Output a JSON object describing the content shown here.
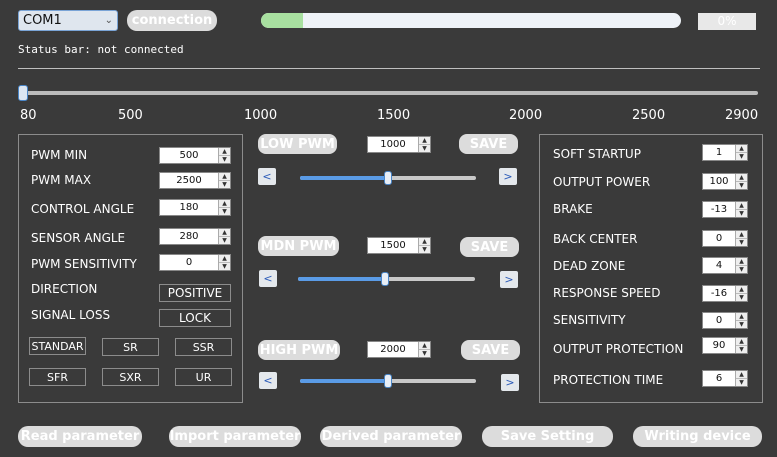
{
  "top": {
    "port": "COM1",
    "connect_label": "connection",
    "progress_fraction": 0.1,
    "progress_text": "0%",
    "status_label": "Status bar:",
    "status_value": "not connected"
  },
  "main_slider": {
    "ticks": [
      "80",
      "500",
      "1000",
      "1500",
      "2000",
      "2500",
      "2900"
    ],
    "value": 80
  },
  "left_panel": {
    "rows": [
      {
        "label": "PWM MIN",
        "value": "500"
      },
      {
        "label": "PWM MAX",
        "value": "2500"
      },
      {
        "label": "CONTROL ANGLE",
        "value": "180"
      },
      {
        "label": "SENSOR ANGLE",
        "value": "280"
      },
      {
        "label": "PWM SENSITIVITY",
        "value": "0"
      }
    ],
    "direction_label": "DIRECTION",
    "direction_value": "POSITIVE",
    "signal_loss_label": "SIGNAL LOSS",
    "signal_loss_value": "LOCK",
    "modes": [
      "STANDAR",
      "SR",
      "SSR",
      "SFR",
      "SXR",
      "UR"
    ]
  },
  "pwm_groups": [
    {
      "label": "LOW PWM",
      "value": "1000",
      "save": "SAVE",
      "prev": "<",
      "next": ">",
      "slider_fraction": 0.5
    },
    {
      "label": "MDN PWM",
      "value": "1500",
      "save": "SAVE",
      "prev": "<",
      "next": ">",
      "slider_fraction": 0.49
    },
    {
      "label": "HIGH PWM",
      "value": "2000",
      "save": "SAVE",
      "prev": "<",
      "next": ">",
      "slider_fraction": 0.5
    }
  ],
  "right_panel": {
    "rows": [
      {
        "label": "SOFT STARTUP",
        "value": "1"
      },
      {
        "label": "OUTPUT POWER",
        "value": "100"
      },
      {
        "label": "BRAKE",
        "value": "-13"
      },
      {
        "label": "BACK CENTER",
        "value": "0"
      },
      {
        "label": "DEAD ZONE",
        "value": "4"
      },
      {
        "label": "RESPONSE SPEED",
        "value": "-16"
      },
      {
        "label": "SENSITIVITY",
        "value": "0"
      },
      {
        "label": "OUTPUT PROTECTION",
        "value": "90"
      },
      {
        "label": "PROTECTION TIME",
        "value": "6"
      }
    ]
  },
  "bottom": {
    "read": "Read parameter",
    "import": "Import parameter",
    "derived": "Derived parameter",
    "save": "Save Setting",
    "write": "Writing device"
  }
}
